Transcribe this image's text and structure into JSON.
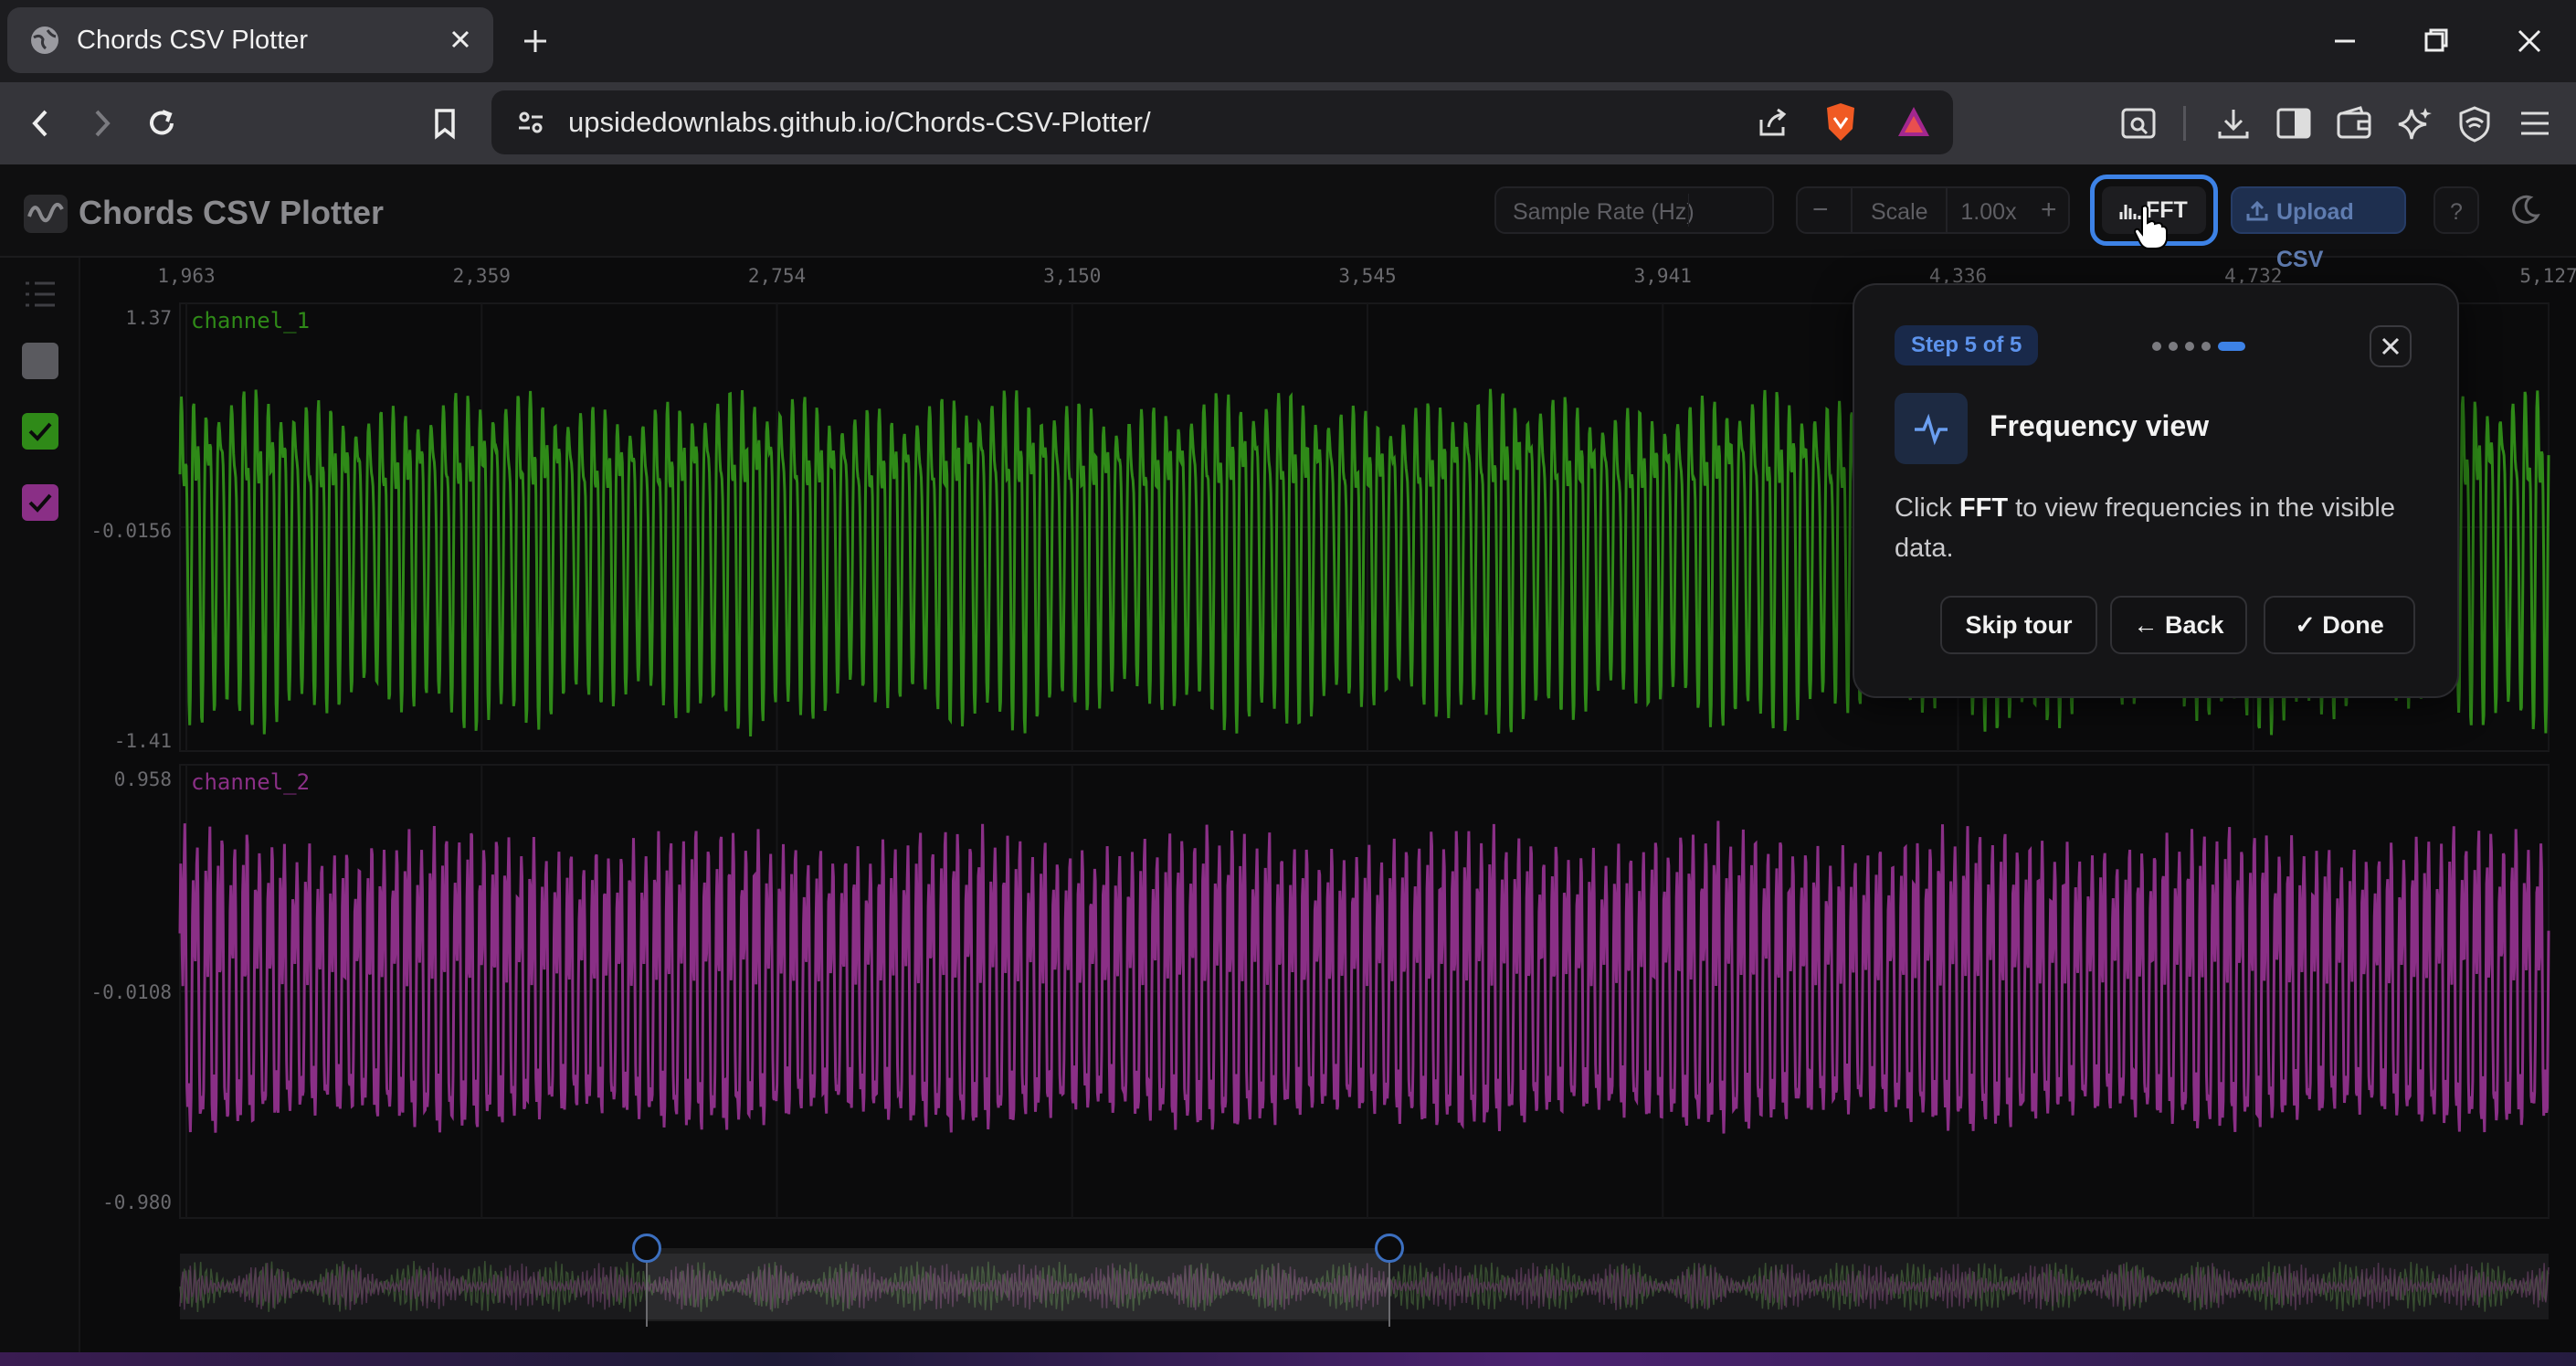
{
  "browser": {
    "tab_title": "Chords CSV Plotter",
    "url": "upsidedownlabs.github.io/Chords-CSV-Plotter/"
  },
  "app": {
    "brand": "Chords CSV Plotter",
    "sample_rate_label": "Sample Rate (Hz)",
    "sample_rate_value": "",
    "scale_label": "Scale",
    "scale_value": "1.00x",
    "scale_minus": "−",
    "scale_plus": "+",
    "fft_label": "FFT",
    "upload_label": "Upload CSV",
    "help_label": "?"
  },
  "channels": [
    {
      "name": "channel_1",
      "color": "#2f8a18",
      "checked": true
    },
    {
      "name": "channel_2",
      "color": "#8a2f86",
      "checked": true
    }
  ],
  "chart_data": {
    "type": "line",
    "x_ticks": [
      "1,963",
      "2,359",
      "2,754",
      "3,150",
      "3,545",
      "3,941",
      "4,336",
      "4,732",
      "5,127"
    ],
    "x_range": [
      1963,
      5127
    ],
    "series": [
      {
        "name": "channel_1",
        "y_ticks": [
          "1.37",
          "-0.0156",
          "-1.41"
        ],
        "ylim": [
          -1.41,
          1.37
        ]
      },
      {
        "name": "channel_2",
        "y_ticks": [
          "0.958",
          "-0.0108",
          "-0.980"
        ],
        "ylim": [
          -0.98,
          0.958
        ]
      }
    ]
  },
  "tour": {
    "step": "Step 5 of 5",
    "title": "Frequency view",
    "body_pre": "Click ",
    "body_bold": "FFT",
    "body_post": " to view frequencies in the visible data.",
    "skip": "Skip tour",
    "back": "← Back",
    "done": "✓ Done"
  },
  "colors": {
    "accent": "#3d82e6",
    "channel_1": "#2f8a18",
    "channel_2": "#8a2f86"
  }
}
